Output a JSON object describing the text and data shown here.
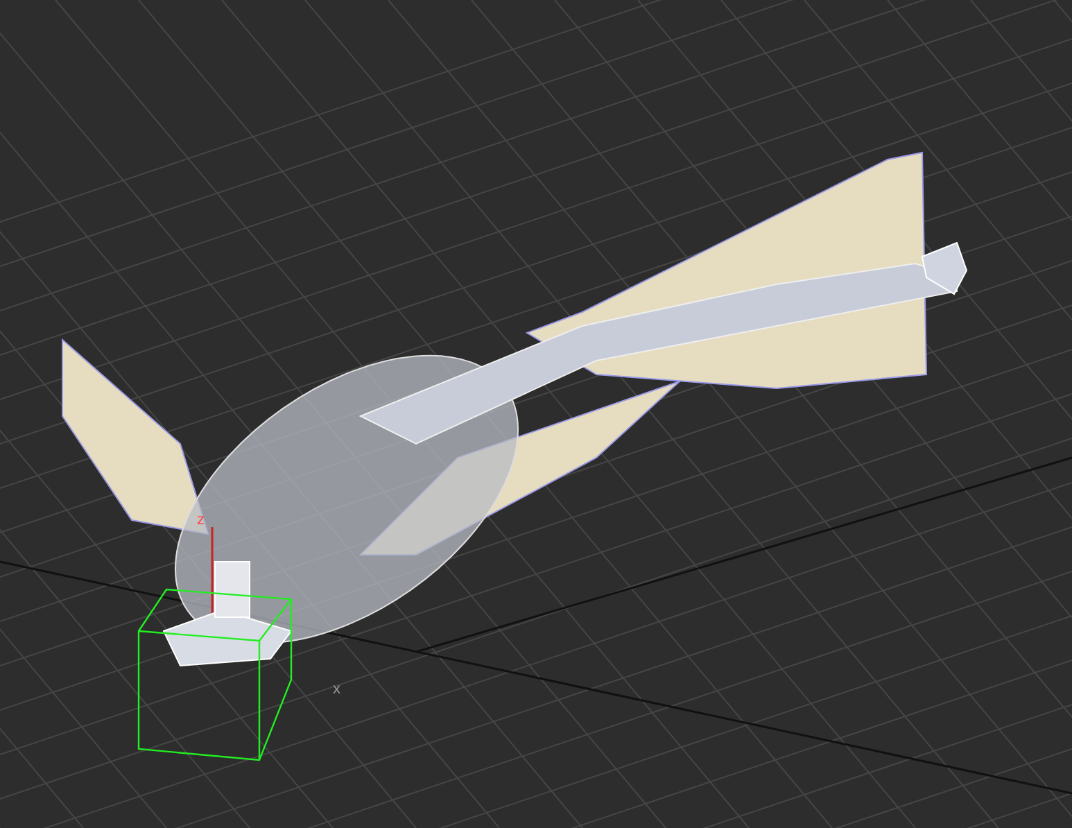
{
  "viewport": {
    "gizmo_axes": [
      {
        "kind": "vertical",
        "label": "z"
      },
      {
        "kind": "horizontal",
        "label": "x"
      }
    ]
  }
}
